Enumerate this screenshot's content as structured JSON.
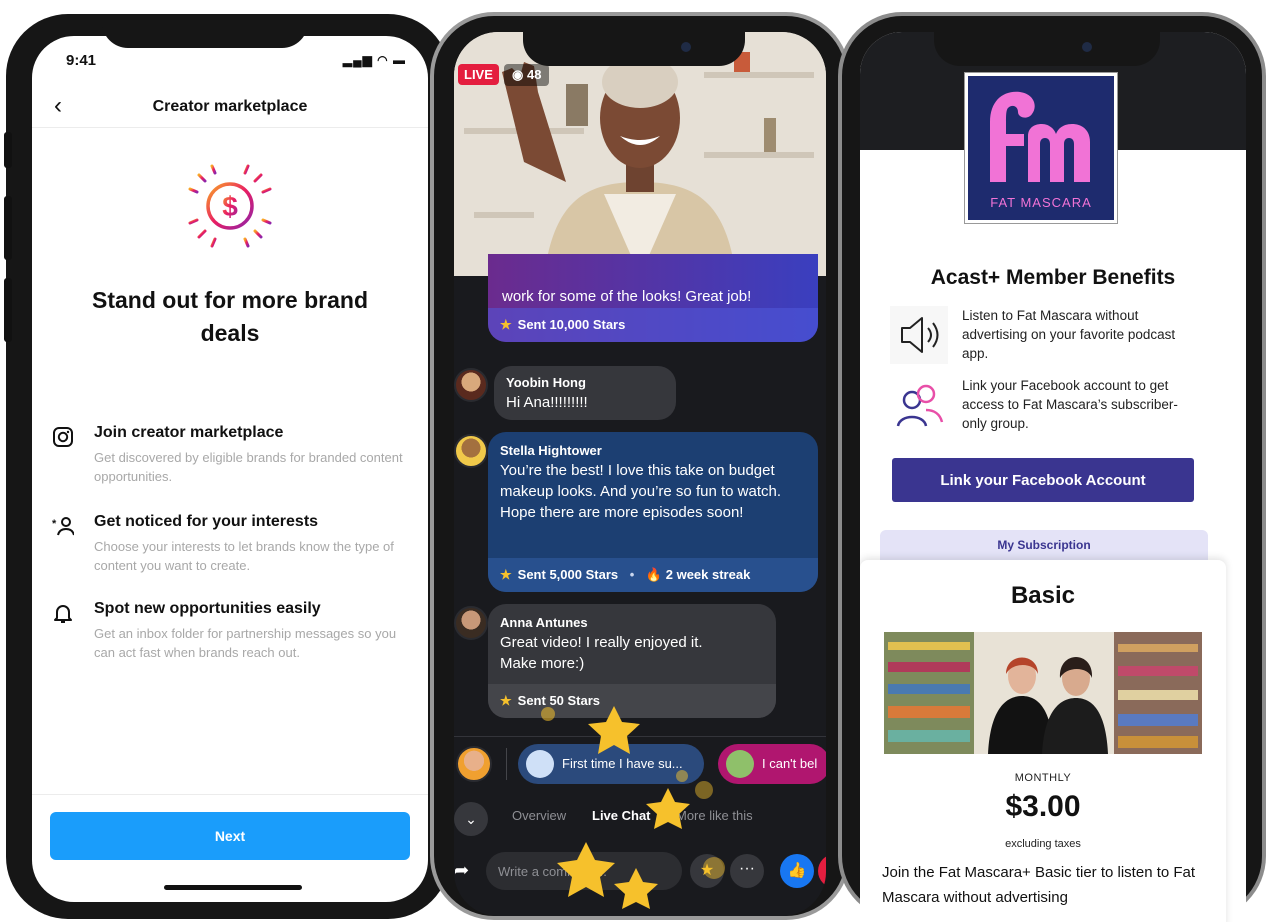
{
  "phone1": {
    "status": {
      "time": "9:41",
      "icons": "▂▄▆ ◠ ▬"
    },
    "header": {
      "back": "‹",
      "title": "Creator marketplace"
    },
    "headline": "Stand out for more brand deals",
    "features": [
      {
        "title": "Join creator marketplace",
        "desc": "Get discovered by eligible brands for branded content opportunities."
      },
      {
        "title": "Get noticed for your interests",
        "desc": "Choose your interests to let brands know the type of content you want to create."
      },
      {
        "title": "Spot new opportunities easily",
        "desc": "Get an inbox folder for partnership messages so you can act fast when brands reach out."
      }
    ],
    "next_label": "Next"
  },
  "phone2": {
    "live": "LIVE",
    "viewers": "48",
    "top_message": "work for some of the looks! Great job!",
    "top_stars": "Sent 10,000 Stars",
    "messages": [
      {
        "name": "Yoobin Hong",
        "text": "Hi Ana!!!!!!!!!"
      },
      {
        "name": "Stella Hightower",
        "text": "You’re the best! I love this take on budget makeup looks. And you’re so fun to watch. Hope there are more episodes soon!",
        "stars": "Sent 5,000 Stars",
        "sep": "•",
        "streak": "2 week streak"
      },
      {
        "name": "Anna Antunes",
        "text": "Great video! I really enjoyed it. Make more:)",
        "stars": "Sent 50 Stars"
      }
    ],
    "chips": [
      "First time I have su...",
      "I can't bel"
    ],
    "tabs": [
      "Overview",
      "Live Chat",
      "More like this"
    ],
    "comment_placeholder": "Write a comment..."
  },
  "phone3": {
    "logo_text": "FAT MASCARA",
    "heading": "Acast+ Member Benefits",
    "benefits": [
      "Listen to Fat Mascara without advertising on your favorite podcast app.",
      "Link your Facebook account to get access to Fat Mascara’s subscriber-only group."
    ],
    "fb_button": "Link your Facebook Account",
    "subscription_tab": "My Subscription",
    "plan": {
      "name": "Basic",
      "period": "MONTHLY",
      "price": "$3.00",
      "tax": "excluding taxes",
      "desc": "Join the Fat Mascara+ Basic tier to listen to Fat Mascara without advertising"
    }
  },
  "colors": {
    "instagram_blue": "#1a9dfb",
    "facebook_dark": "#191a1e",
    "acast_purple": "#3a3590",
    "star_gold": "#f6c12c",
    "live_red": "#e41e3f"
  }
}
